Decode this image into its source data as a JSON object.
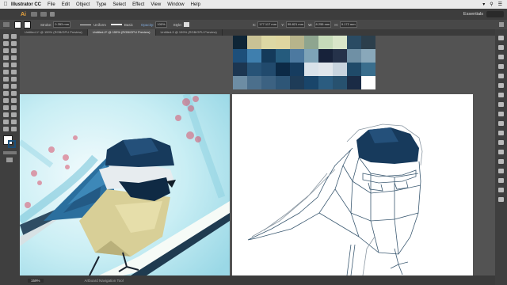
{
  "menubar": {
    "apple": "",
    "app_name": "Illustrator CC",
    "items": [
      "File",
      "Edit",
      "Object",
      "Type",
      "Select",
      "Effect",
      "View",
      "Window",
      "Help"
    ]
  },
  "appbar": {
    "logo": "Ai",
    "workspace": "Essentials"
  },
  "control": {
    "stroke_label": "Stroke:",
    "stroke_value": "0.353 mm",
    "profile": "Uniform",
    "brush": "Basic",
    "opacity_label": "Opacity:",
    "opacity_value": "100%",
    "style_label": "Style:",
    "x_label": "X:",
    "x_value": "177.117 mm",
    "y_label": "Y:",
    "y_value": "55.821 mm",
    "w_label": "W:",
    "w_value": "8.255 mm",
    "h_label": "H:",
    "h_value": "9.172 mm"
  },
  "tabs": [
    "Untitled-1* @ 159% (RGB/GPU Preview)",
    "Untitled-2* @ 159% (RGB/GPU Preview)",
    "Untitled-3 @ 159% (RGB/GPU Preview)"
  ],
  "status": {
    "zoom": "159%",
    "tool": "Artboard Navigation Tool"
  },
  "colors": {
    "palette_rows": [
      [
        "#0e2536",
        "#c9c295",
        "#ddd8a4",
        "#dfd6a0",
        "#b7b48b",
        "#8ea58f",
        "#c6dbb9",
        "#d9e6c9",
        "#2a4b63",
        "#2c3f4c"
      ],
      [
        "#1d4f7a",
        "#3f7fae",
        "#143a5a",
        "#255b7d",
        "#4c79a0",
        "#7ea3b7",
        "#17223a",
        "#25324a",
        "#6f90a5",
        "#89a8ba"
      ],
      [
        "#1c3651",
        "#275377",
        "#214a6d",
        "#0c2a46",
        "#163c5f",
        "#d9e2ea",
        "#e0e6ec",
        "#c8d4df",
        "#1f4a69",
        "#3a6e8d"
      ],
      [
        "#6d8da4",
        "#4b6f8c",
        "#3c6282",
        "#2e5677",
        "#1e3c58",
        "#19456a",
        "#2b5c80",
        "#27516f",
        "#1a2b45",
        "#ffffff"
      ]
    ]
  }
}
